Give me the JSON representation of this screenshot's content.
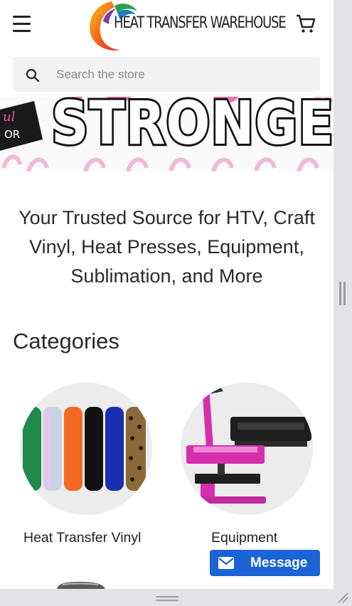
{
  "header": {
    "menu_icon": "hamburger-icon",
    "logo_text": "HEAT TRANSFER WAREHOUSE",
    "cart_icon": "cart-icon"
  },
  "search": {
    "placeholder": "Search the store",
    "value": "",
    "icon": "search-icon"
  },
  "banner": {
    "text": "STRONGER",
    "badge_text_line1": "ul",
    "badge_text_line2": "OR",
    "colors": {
      "pink": "#e85aa0",
      "black": "#111111"
    }
  },
  "tagline": "Your Trusted Source for HTV, Craft Vinyl, Heat Presses, Equipment, Sublimation, and More",
  "categories": {
    "title": "Categories",
    "items": [
      {
        "label": "Heat Transfer Vinyl"
      },
      {
        "label": "Equipment"
      }
    ]
  },
  "message_button": {
    "label": "Message",
    "icon": "envelope-icon",
    "color": "#1b63d6"
  }
}
